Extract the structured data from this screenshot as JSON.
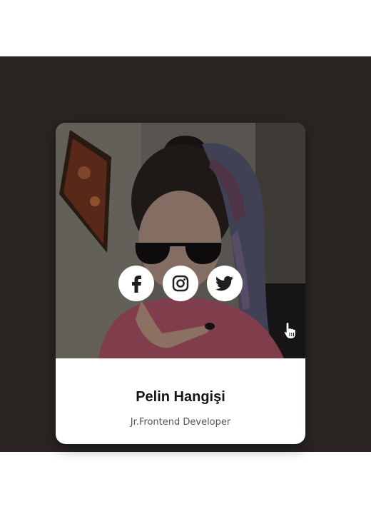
{
  "profile": {
    "name": "Pelin Hangişi",
    "role": "Jr.Frontend Developer"
  },
  "social_links": [
    {
      "icon": "facebook-icon"
    },
    {
      "icon": "instagram-icon"
    },
    {
      "icon": "twitter-icon"
    }
  ],
  "colors": {
    "page_background": "#ffffff",
    "stage_background": "#2a2523",
    "card_background": "#ffffff",
    "icon_color": "#1f1f1f",
    "name_color": "#141414",
    "role_color": "#555555"
  }
}
